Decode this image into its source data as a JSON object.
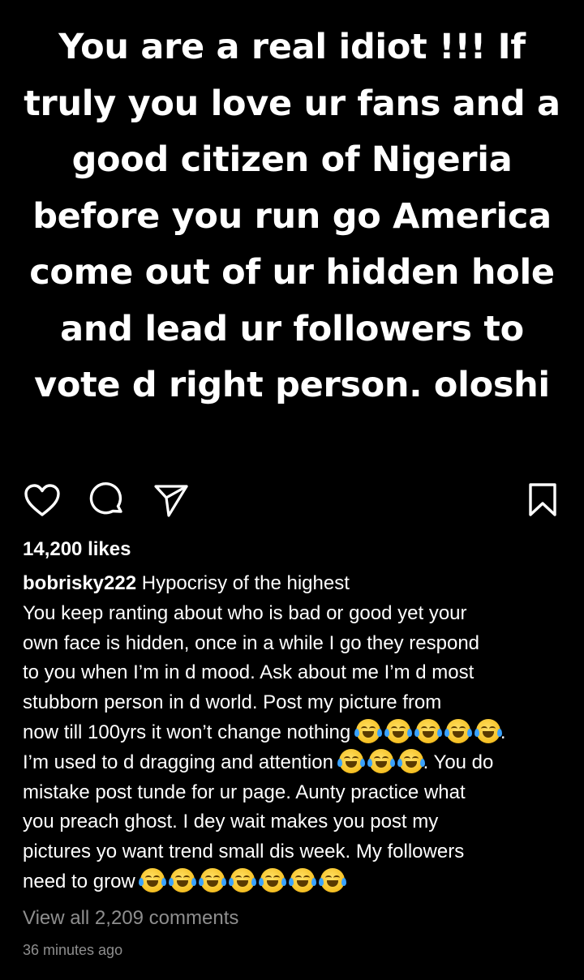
{
  "post": {
    "image_text": "You are a real idiot !!! If truly you love ur fans and a good citizen of Nigeria before you run go America come out of ur hidden hole and lead ur followers to vote d right person. oloshi"
  },
  "actions": {
    "like_icon": "heart-icon",
    "comment_icon": "comment-icon",
    "share_icon": "paper-plane-icon",
    "save_icon": "bookmark-icon"
  },
  "likes_text": "14,200 likes",
  "caption": {
    "username": "bobrisky222",
    "first_line": " Hypocrisy of the highest",
    "lines": [
      "You keep ranting about who is bad or good yet your",
      "own face is hidden, once in a while I go they respond",
      "to you when I’m in d mood. Ask about me I’m d most",
      "stubborn person in d world. Post my picture from"
    ],
    "line_emoji_1_text": "now till 100yrs it won’t change nothing",
    "line_emoji_1_after": ".",
    "line_emoji_2_text": "I’m used to d dragging and attention",
    "line_emoji_2_after": ". You do",
    "lines_2": [
      "mistake post tunde for ur page. Aunty practice what",
      "you preach ghost. I dey wait makes you post my",
      "pictures yo want trend small dis week. My followers"
    ],
    "last_line_text": "need to grow"
  },
  "emoji": {
    "name": "face-with-tears-of-joy",
    "color": "#f7c52b"
  },
  "view_comments_text": "View all 2,209 comments",
  "timestamp": "36 minutes ago",
  "colors": {
    "background": "#000000",
    "text": "#ffffff",
    "muted": "#8e8e8e"
  }
}
